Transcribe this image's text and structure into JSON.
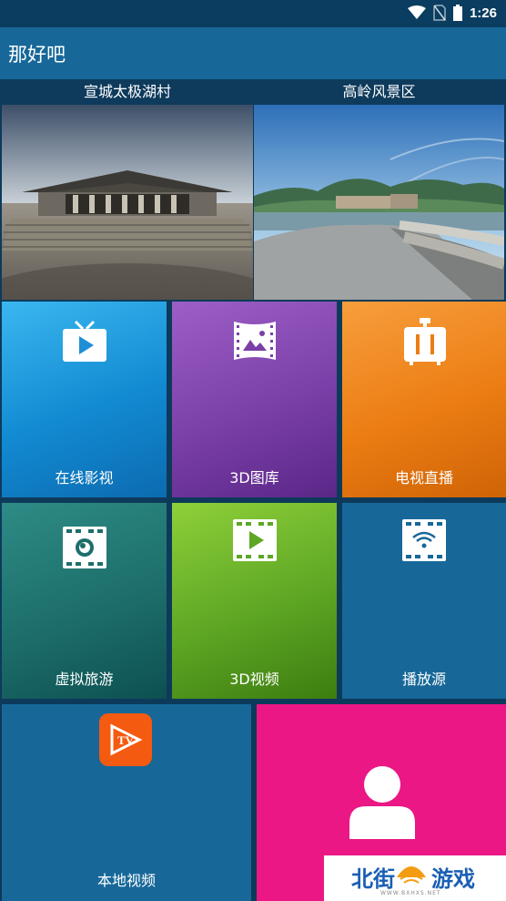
{
  "status": {
    "time": "1:26",
    "icons": [
      "wifi-icon",
      "no-sim-icon",
      "battery-icon"
    ]
  },
  "app": {
    "title": "那好吧"
  },
  "banners": [
    {
      "caption": "宣城太极湖村"
    },
    {
      "caption": "高岭风景区"
    }
  ],
  "tiles": {
    "online_video": {
      "label": "在线影视",
      "icon": "tv-play-icon"
    },
    "gallery_3d": {
      "label": "3D图库",
      "icon": "panorama-film-icon"
    },
    "tv_live": {
      "label": "电视直播",
      "icon": "suitcase-icon"
    },
    "virtual_tour": {
      "label": "虚拟旅游",
      "icon": "film-globe-icon"
    },
    "video_3d": {
      "label": "3D视频",
      "icon": "film-play-icon"
    },
    "play_source": {
      "label": "播放源",
      "icon": "film-wifi-icon"
    },
    "local_video": {
      "label": "本地视频",
      "icon": "tv-logo-icon",
      "logo_text": "TV"
    },
    "user": {
      "icon": "user-icon"
    }
  },
  "watermark": {
    "left": "北街",
    "right": "游戏",
    "sub": "WWW.BXHXS.NET"
  },
  "colors": {
    "appbar": "#176899",
    "online": "#128ad2",
    "gallery": "#7b3fa8",
    "tv": "#ec7d14",
    "tour": "#1d6e6b",
    "video3d": "#5ea624",
    "source": "#176899",
    "user": "#ea1785"
  }
}
